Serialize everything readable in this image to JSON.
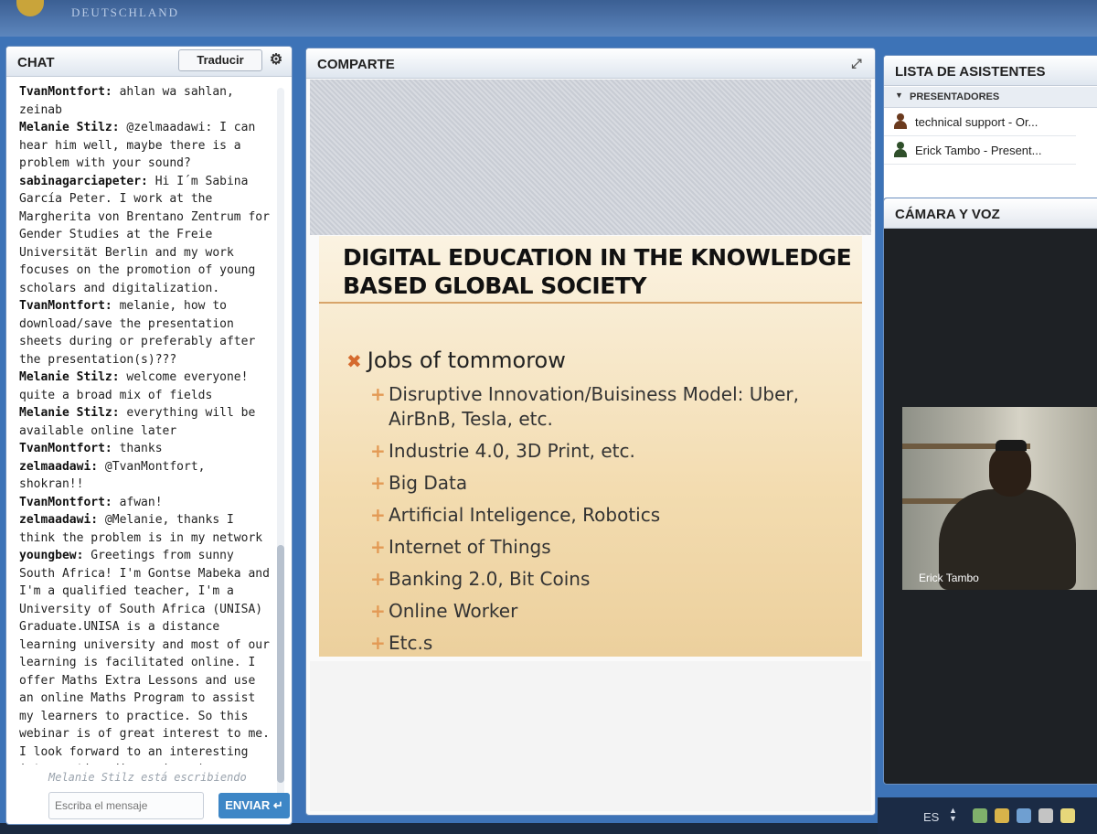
{
  "header": {
    "org_text": "DEUTSCHLAND"
  },
  "chat": {
    "title": "CHAT",
    "translate_label": "Traducir",
    "messages": [
      {
        "user": "TvanMontfort:",
        "text": " ahlan wa sahlan, zeinab"
      },
      {
        "user": "Melanie Stilz:",
        "text": " @zelmaadawi: I can hear him well, maybe there is a problem with your sound?"
      },
      {
        "user": "sabinagarciapeter:",
        "text": " Hi I´m Sabina García Peter. I work at the Margherita von Brentano Zentrum for Gender Studies at the Freie Universität Berlin and my work focuses on the promotion of young scholars and digitalization."
      },
      {
        "user": "TvanMontfort:",
        "text": " melanie, how to download/save the presentation sheets during or preferably after the presentation(s)???"
      },
      {
        "user": "Melanie Stilz:",
        "text": " welcome everyone! quite a broad mix of fields"
      },
      {
        "user": "Melanie Stilz:",
        "text": " everything will be available online later"
      },
      {
        "user": "TvanMontfort:",
        "text": " thanks"
      },
      {
        "user": "zelmaadawi:",
        "text": " @TvanMontfort, shokran!!"
      },
      {
        "user": "TvanMontfort:",
        "text": " afwan!"
      },
      {
        "user": "zelmaadawi:",
        "text": " @Melanie, thanks I think the problem is in my network"
      },
      {
        "user": "youngbew:",
        "text": " Greetings from sunny South Africa! I'm Gontse Mabeka and I'm a qualified teacher, I'm a University of South Africa (UNISA) Graduate.UNISA is a distance learning university and most of our learning is facilitated online. I offer Maths Extra Lessons and use an online Maths Program to assist my learners to practice. So this webinar is of great interest to me. I look forward to an interesting inter-active discussion :)"
      }
    ],
    "typing_indicator": "Melanie Stilz está escribiendo",
    "input_placeholder": "Escriba el mensaje",
    "send_label": "ENVIAR ↵"
  },
  "share": {
    "title": "COMPARTE",
    "slide": {
      "title": "DIGITAL EDUCATION IN THE KNOWLEDGE BASED GLOBAL SOCIETY",
      "main_bullet": "Jobs of tommorow",
      "sub_bullets": [
        "Disruptive Innovation/Buisiness Model: Uber, AirBnB, Tesla, etc.",
        "Industrie 4.0, 3D Print, etc.",
        "Big Data",
        "Artificial Inteligence, Robotics",
        "Internet of Things",
        "Banking 2.0, Bit Coins",
        "Online Worker",
        "Etc.s"
      ]
    }
  },
  "attendees": {
    "title": "LISTA DE ASISTENTES",
    "group_label": "PRESENTADORES",
    "list": [
      {
        "name": "technical support - Or...",
        "color": "#6b3a1e"
      },
      {
        "name": "Erick Tambo - Present...",
        "color": "#2f4f2a"
      }
    ]
  },
  "camera": {
    "title": "CÁMARA Y VOZ",
    "video_label": "Erick Tambo"
  },
  "taskbar": {
    "language": "ES"
  }
}
